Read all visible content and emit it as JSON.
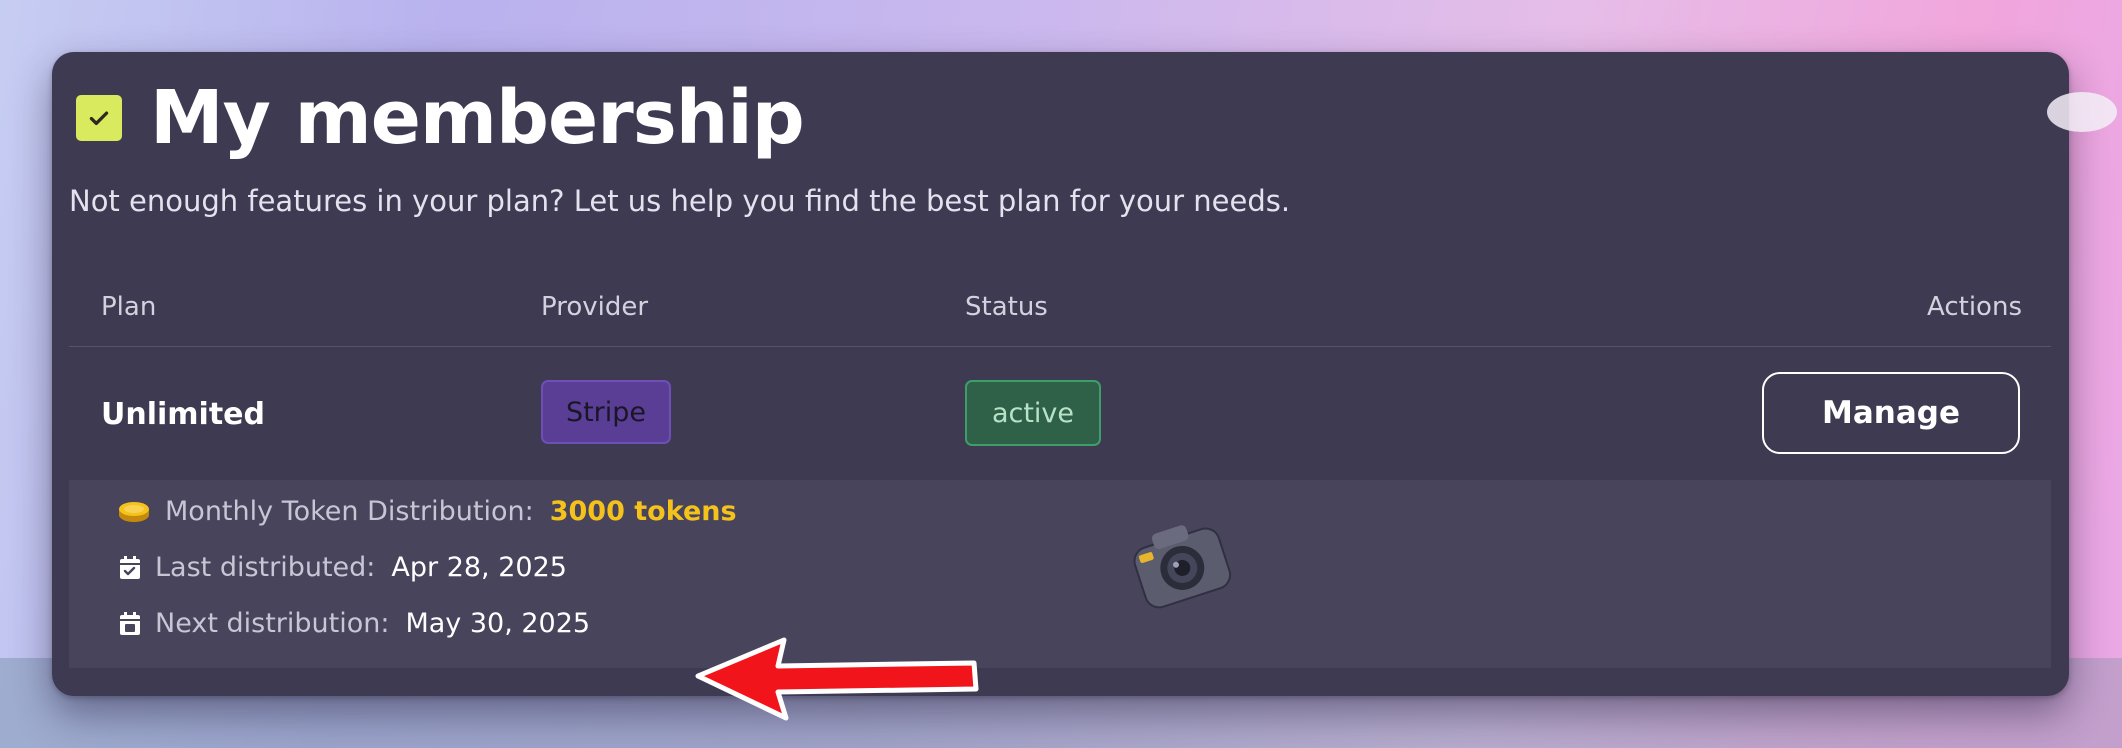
{
  "header": {
    "title": "My membership",
    "subtitle": "Not enough features in your plan? Let us help you find the best plan for your needs."
  },
  "table": {
    "headers": {
      "plan": "Plan",
      "provider": "Provider",
      "status": "Status",
      "actions": "Actions"
    },
    "row": {
      "plan": "Unlimited",
      "provider": "Stripe",
      "status": "active",
      "action_label": "Manage"
    }
  },
  "details": {
    "tokens_label": "Monthly Token Distribution:",
    "tokens_value": "3000 tokens",
    "last_label": "Last distributed:",
    "last_value": "Apr 28, 2025",
    "next_label": "Next distribution:",
    "next_value": "May 30, 2025"
  },
  "icons": {
    "title": "checkbox-icon",
    "tokens": "coin-stack-icon",
    "last": "calendar-check-icon",
    "next": "calendar-date-icon",
    "overlay": "camera-icon",
    "annotation": "red-arrow-icon"
  },
  "colors": {
    "accent_check": "#d9ea5e",
    "tokens_highlight": "#f5c21c",
    "stripe_badge": "#5a3e96",
    "active_badge": "#2f6048",
    "arrow": "#f2141b"
  }
}
